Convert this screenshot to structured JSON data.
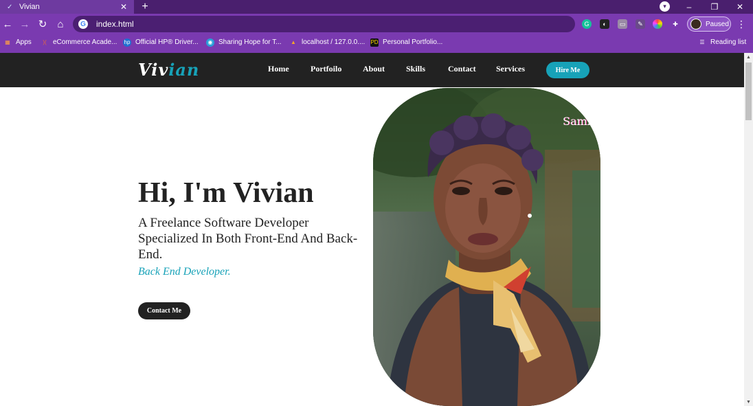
{
  "browser": {
    "tab_title": "Vivian",
    "url": "index.html",
    "profile_status": "Paused",
    "bookmarks": [
      "Apps",
      "eCommerce Acade...",
      "Official HP® Driver...",
      "Sharing Hope for T...",
      "localhost / 127.0.0....",
      "Personal Portfolio..."
    ],
    "reading_list": "Reading list"
  },
  "site": {
    "logo_part1": "Viv",
    "logo_part2": "ian",
    "menu": [
      "Home",
      "Portfoilo",
      "About",
      "Skills",
      "Contact",
      "Services"
    ],
    "hire_button": "Hire Me",
    "hero_title": "Hi, I'm Vivian",
    "hero_subtitle": "A Freelance Software Developer Specialized In Both Front-End And Back-End.",
    "hero_role": "Back End Developer.",
    "contact_button": "Contact Me",
    "photo_watermark": "Samic"
  },
  "colors": {
    "accent": "#17a2b8",
    "nav_bg": "#222222",
    "browser_purple": "#7a3ab0"
  }
}
